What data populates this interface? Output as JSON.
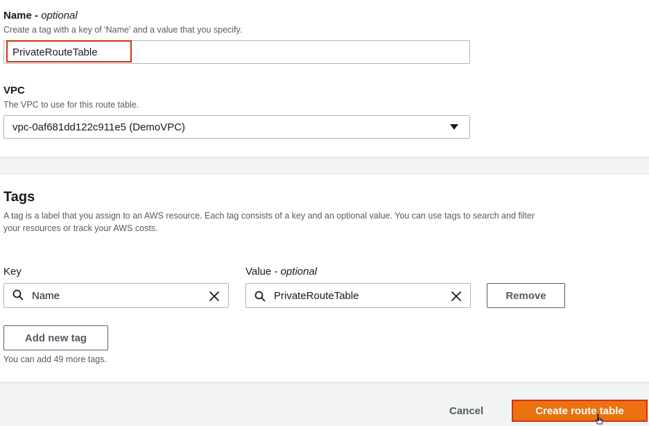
{
  "general": {
    "name_label": "Name - ",
    "name_optional": "optional",
    "name_desc": "Create a tag with a key of 'Name' and a value that you specify.",
    "name_value": "PrivateRouteTable",
    "vpc_label": "VPC",
    "vpc_desc": "The VPC to use for this route table.",
    "vpc_selected": "vpc-0af681dd122c911e5 (DemoVPC)"
  },
  "tags": {
    "title": "Tags",
    "desc_line1": "A tag is a label that you assign to an AWS resource. Each tag consists of a key and an optional value. You can use tags to search and filter",
    "desc_line2": "your resources or track your AWS costs.",
    "key_label": "Key",
    "value_label": "Value - ",
    "value_optional": "optional",
    "rows": [
      {
        "key": "Name",
        "value": "PrivateRouteTable",
        "remove_label": "Remove"
      }
    ],
    "add_label": "Add new tag",
    "remaining_text": "You can add 49 more tags."
  },
  "footer": {
    "cancel_label": "Cancel",
    "create_label": "Create route table"
  },
  "colors": {
    "primary": "#ec7211",
    "highlight": "#d13212"
  }
}
